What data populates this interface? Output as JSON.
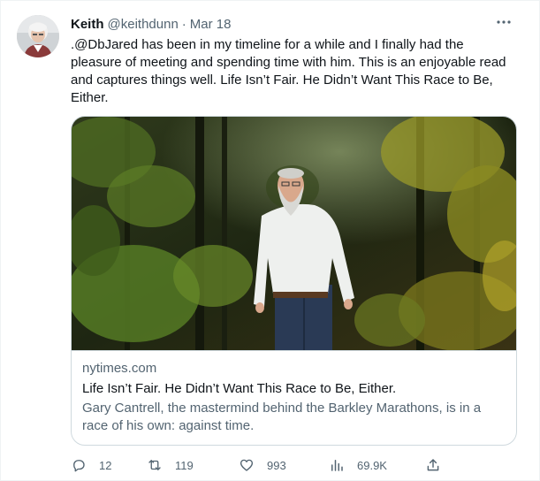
{
  "tweet": {
    "author_name": "Keith",
    "author_handle": "@keithdunn",
    "separator": "·",
    "date": "Mar 18",
    "text": ".@DbJared has been in my timeline for a while and I finally had the pleasure of meeting and spending time with him.  This is an enjoyable read and captures things well. Life Isn’t Fair. He Didn’t Want This Race to Be, Either."
  },
  "card": {
    "domain": "nytimes.com",
    "title": "Life Isn’t Fair. He Didn’t Want This Race to Be, Either.",
    "description": "Gary Cantrell, the mastermind behind the Barkley Marathons, is in a race of his own: against time."
  },
  "actions": {
    "replies": "12",
    "retweets": "119",
    "likes": "993",
    "views": "69.9K"
  },
  "icons": {
    "more": "more-dots-icon",
    "reply": "reply-icon",
    "retweet": "retweet-icon",
    "like": "heart-icon",
    "views": "views-icon",
    "share": "share-icon"
  },
  "colors": {
    "text_primary": "#0f1419",
    "text_secondary": "#536471",
    "border": "#cfd9de"
  }
}
